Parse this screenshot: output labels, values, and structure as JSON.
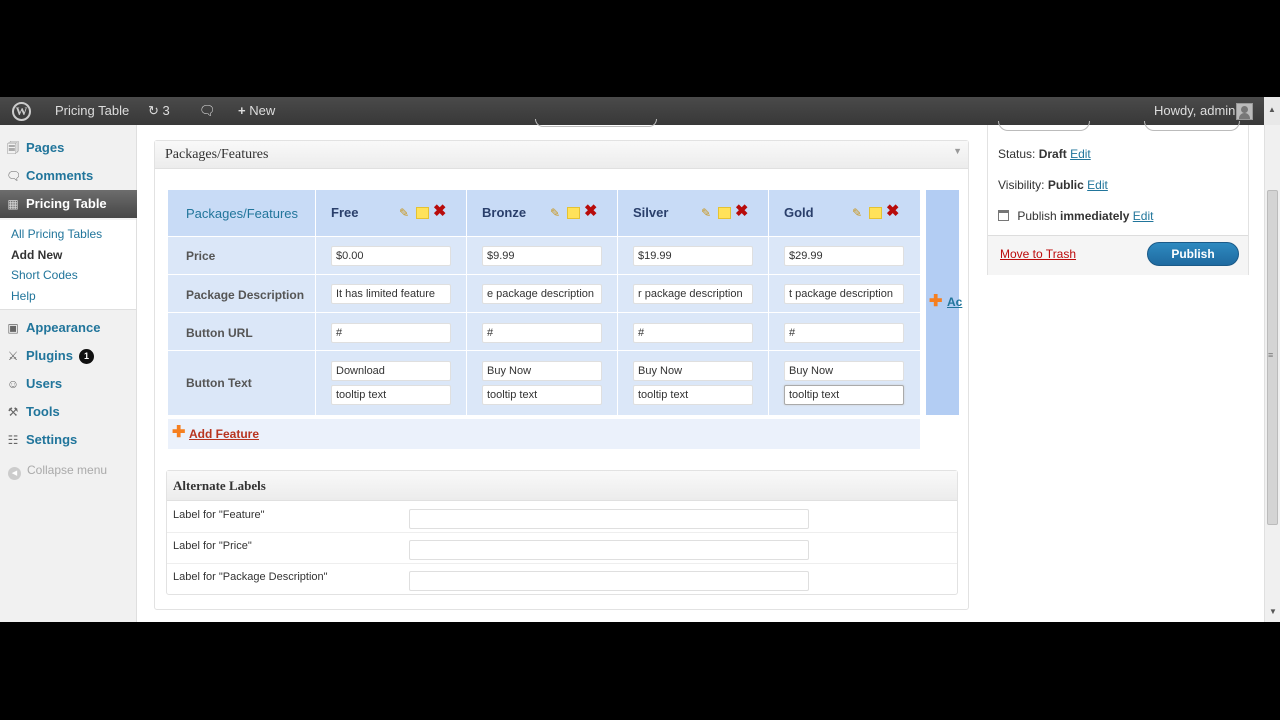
{
  "adminbar": {
    "site": "Pricing Table",
    "updates": "3",
    "new": "New",
    "howdy": "Howdy, admin"
  },
  "menu": {
    "pages": "Pages",
    "comments": "Comments",
    "pricing_table": "Pricing Table",
    "submenu": [
      "All Pricing Tables",
      "Add New",
      "Short Codes",
      "Help"
    ],
    "appearance": "Appearance",
    "plugins": "Plugins",
    "plugins_badge": "1",
    "users": "Users",
    "tools": "Tools",
    "settings": "Settings",
    "collapse": "Collapse menu"
  },
  "packages_box": {
    "title": "Packages/Features",
    "header_label": "Packages/Features",
    "row_labels": [
      "Price",
      "Package Description",
      "Button URL",
      "Button Text"
    ],
    "packages": [
      {
        "name": "Free",
        "price": "$0.00",
        "description": "It has limited feature",
        "url": "#",
        "button_text": "Download",
        "tooltip": "tooltip text"
      },
      {
        "name": "Bronze",
        "price": "$9.99",
        "description": "e package description",
        "url": "#",
        "button_text": "Buy Now",
        "tooltip": "tooltip text"
      },
      {
        "name": "Silver",
        "price": "$19.99",
        "description": "r  package description",
        "url": "#",
        "button_text": "Buy Now",
        "tooltip": "tooltip text"
      },
      {
        "name": "Gold",
        "price": "$29.99",
        "description": "t  package description",
        "url": "#",
        "button_text": "Buy Now",
        "tooltip": "tooltip text"
      }
    ],
    "add_column": "Ac",
    "add_feature": "Add Feature"
  },
  "alternate_labels": {
    "title": "Alternate Labels",
    "rows": [
      "Label for \"Feature\"",
      "Label for \"Price\"",
      "Label for \"Package Description\""
    ]
  },
  "publish_box": {
    "status_label": "Status:",
    "status_value": "Draft",
    "visibility_label": "Visibility:",
    "visibility_value": "Public",
    "publish_label": "Publish",
    "publish_value": "immediately",
    "edit": "Edit",
    "trash": "Move to Trash",
    "publish_button": "Publish"
  }
}
